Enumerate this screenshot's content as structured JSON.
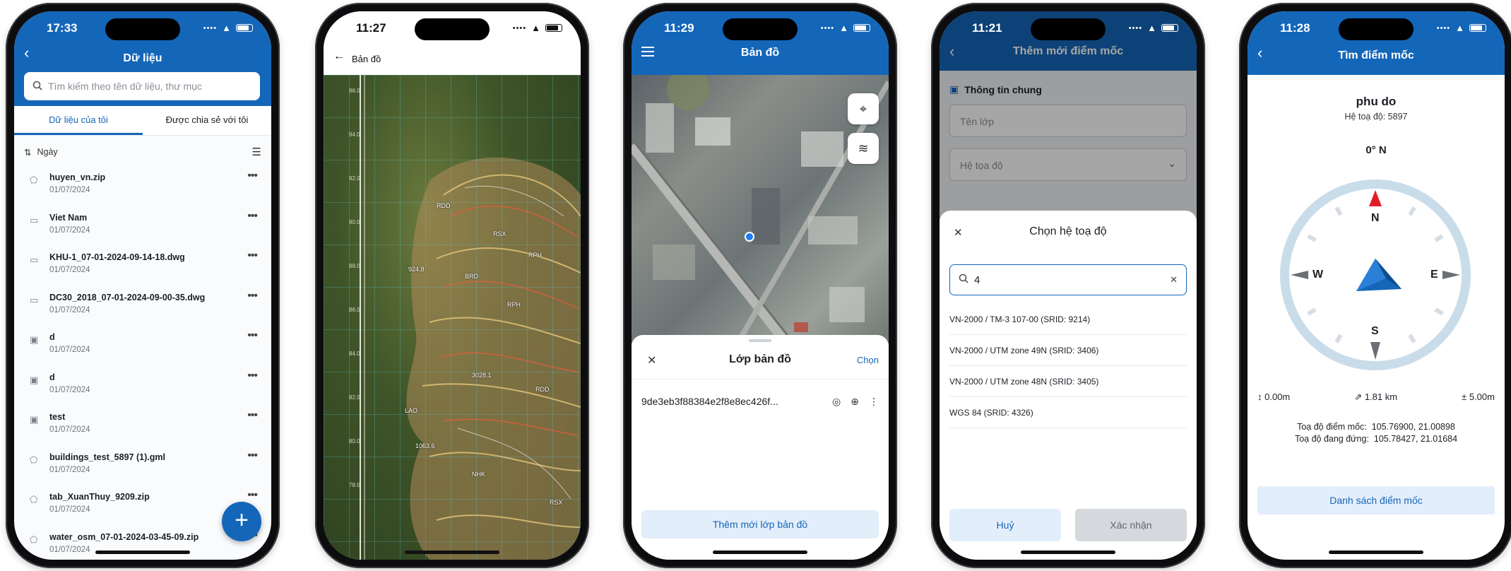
{
  "colors": {
    "primary": "#1466b8",
    "primary_light": "#e3eefb",
    "compass_ring": "#c9dcea",
    "north": "#e11d2b"
  },
  "phone1": {
    "time": "17:33",
    "title": "Dữ liệu",
    "search_placeholder": "Tìm kiếm theo tên dữ liệu, thư mục",
    "tabs": [
      "Dữ liệu của tôi",
      "Được chia sẻ với tôi"
    ],
    "sort_label": "Ngày",
    "items": [
      {
        "name": "huyen_vn.zip",
        "date": "01/07/2024",
        "icon": "file-icon"
      },
      {
        "name": "Viet Nam",
        "date": "01/07/2024",
        "icon": "folder-icon"
      },
      {
        "name": "KHU-1_07-01-2024-09-14-18.dwg",
        "date": "01/07/2024",
        "icon": "folder-icon"
      },
      {
        "name": "DC30_2018_07-01-2024-09-00-35.dwg",
        "date": "01/07/2024",
        "icon": "folder-icon"
      },
      {
        "name": "d",
        "date": "01/07/2024",
        "icon": "image-icon"
      },
      {
        "name": "d",
        "date": "01/07/2024",
        "icon": "image-icon"
      },
      {
        "name": "test",
        "date": "01/07/2024",
        "icon": "image-icon"
      },
      {
        "name": "buildings_test_5897 (1).gml",
        "date": "01/07/2024",
        "icon": "file-icon"
      },
      {
        "name": "tab_XuanThuy_9209.zip",
        "date": "01/07/2024",
        "icon": "file-icon"
      },
      {
        "name": "water_osm_07-01-2024-03-45-09.zip",
        "date": "01/07/2024",
        "icon": "file-icon"
      }
    ],
    "fab": "+"
  },
  "phone2": {
    "time": "11:27",
    "title": "Bản đồ",
    "grid_labels": [
      "96.0",
      "94.0",
      "92.0",
      "90.0",
      "88.0",
      "86.0",
      "84.0",
      "82.0",
      "80.0",
      "78.0"
    ],
    "map_labels": [
      "RDD",
      "RSX",
      "RPH",
      "BRD",
      "LAO",
      "NHK",
      "924.8",
      "3028.1",
      "1063.6",
      "RDD",
      "RPH",
      "RSX"
    ]
  },
  "phone3": {
    "time": "11:29",
    "title": "Bản đồ",
    "sheet_title": "Lớp bản đồ",
    "choose": "Chọn",
    "layer_name": "9de3eb3f88384e2f8e8ec426f...",
    "add_button": "Thêm mới lớp bản đồ"
  },
  "phone4": {
    "time": "11:21",
    "title": "Thêm mới điểm mốc",
    "section": "Thông tin chung",
    "field_name_placeholder": "Tên lớp",
    "field_crs_placeholder": "Hệ tọa độ",
    "sheet_title": "Chọn hệ toạ độ",
    "search_value": "4",
    "options": [
      "VN-2000 / TM-3 107-00 (SRID: 9214)",
      "VN-2000 / UTM zone 49N (SRID: 3406)",
      "VN-2000 / UTM zone 48N (SRID: 3405)",
      "WGS 84 (SRID: 4326)"
    ],
    "cancel": "Huỷ",
    "confirm": "Xác nhận"
  },
  "phone5": {
    "time": "11:28",
    "title": "Tìm điểm mốc",
    "point_name": "phu do",
    "crs_line": "Hệ toạ độ: 5897",
    "heading": "0° N",
    "dirs": {
      "n": "N",
      "e": "E",
      "s": "S",
      "w": "W"
    },
    "stats": [
      "0.00m",
      "1.81 km",
      "± 5.00m"
    ],
    "coord1_label": "Toạ độ điểm mốc:",
    "coord1_value": "105.76900, 21.00898",
    "coord2_label": "Toạ độ đang đứng:",
    "coord2_value": "105.78427, 21.01684",
    "list_button": "Danh sách điểm mốc"
  }
}
